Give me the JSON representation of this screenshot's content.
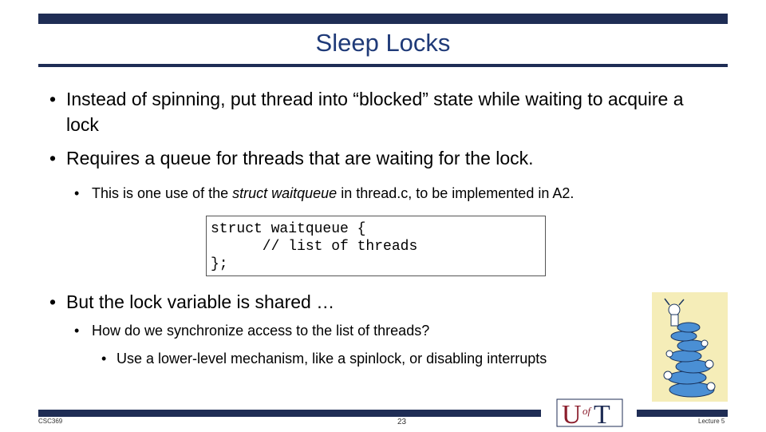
{
  "slide": {
    "title": "Sleep Locks",
    "bullets": [
      {
        "text": "Instead of spinning, put thread into “blocked” state while waiting to acquire a lock"
      },
      {
        "text": "Requires a queue for threads that are waiting for the lock."
      },
      {
        "text_before": "This is one use of the ",
        "text_italic": "struct waitqueue",
        "text_after": " in thread.c, to be implemented in A2."
      },
      {
        "text": "But the lock variable is shared …"
      },
      {
        "text": "How do we synchronize access to the list of threads?"
      },
      {
        "text": "Use a lower-level mechanism, like a spinlock, or disabling interrupts"
      }
    ],
    "bullet_glyph": "•",
    "code": [
      "struct waitqueue {",
      "      // list of threads",
      "};"
    ]
  },
  "footer": {
    "course": "CSC369",
    "page_number": "23",
    "lecture": "Lecture 5"
  },
  "logo": {
    "letter_u": "U",
    "letter_of": "of",
    "letter_t": "T"
  },
  "colors": {
    "navy": "#1f2d55",
    "title_blue": "#1f3a78",
    "logo_red": "#8b1d2c"
  },
  "icons": {
    "cartoon": "cartoon-stacked-turtles-image"
  }
}
